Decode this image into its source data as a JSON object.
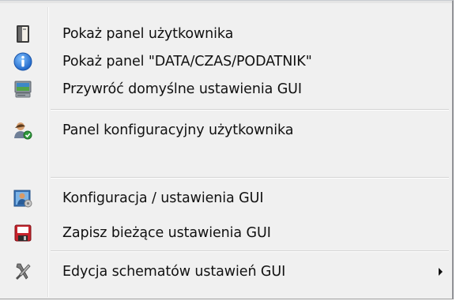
{
  "menu": {
    "items": [
      {
        "label": "Pokaż panel użytkownika",
        "icon": "user-panel-icon"
      },
      {
        "label": "Pokaż panel \"DATA/CZAS/PODATNIK\"",
        "icon": "info-icon"
      },
      {
        "label": "Przywróć domyślne ustawienia GUI",
        "icon": "monitor-restore-icon"
      },
      {
        "label": "Panel konfiguracyjny użytkownika",
        "icon": "user-config-icon"
      },
      {
        "label": "Konfiguracja / ustawienia GUI",
        "icon": "gui-settings-icon"
      },
      {
        "label": "Zapisz bieżące ustawienia GUI",
        "icon": "save-icon"
      },
      {
        "label": "Edycja schematów ustawień GUI",
        "icon": "tools-icon",
        "has_submenu": true
      }
    ]
  },
  "colors": {
    "menu_background": "#f0f0f0",
    "info_blue": "#2f7fd8",
    "save_red": "#c8232c"
  }
}
